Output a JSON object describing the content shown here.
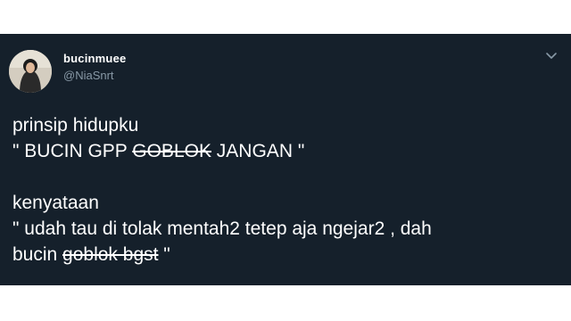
{
  "tweet": {
    "display_name": "bucinmuee",
    "handle": "@NiaSnrt",
    "lines": {
      "l1": "prinsip hidupku",
      "l2_before": "\" BUCIN GPP ",
      "l2_struck": "GOBLOK",
      "l2_after": " JANGAN \"",
      "l3": "kenyataan",
      "l4": "\" udah tau di tolak mentah2 tetep aja ngejar2 , dah",
      "l5_before": "bucin ",
      "l5_struck": "goblok bgst",
      "l5_after": " \""
    }
  },
  "icons": {
    "more": "chevron-down-icon"
  },
  "colors": {
    "background": "#15202b",
    "text": "#ffffff",
    "secondary_text": "#8899a6",
    "page": "#ffffff"
  }
}
